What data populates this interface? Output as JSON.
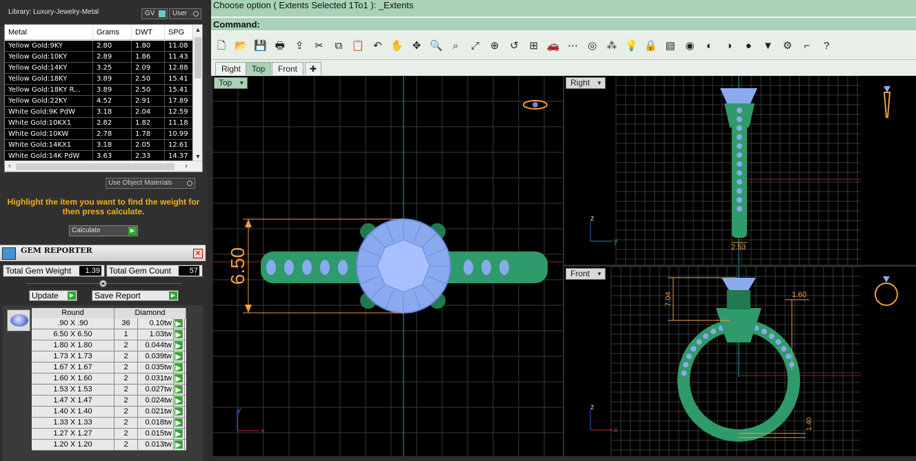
{
  "library": {
    "title": "Library: Luxury-Jewelry-Metal",
    "gv_label": "GV",
    "user_label": "User"
  },
  "metal_table": {
    "headers": [
      "Metal",
      "Grams",
      "DWT",
      "SPG"
    ],
    "rows": [
      [
        "Yellow Gold:9KY",
        "2.80",
        "1.80",
        "11.08"
      ],
      [
        "Yellow Gold:10KY",
        "2.89",
        "1.86",
        "11.43"
      ],
      [
        "Yellow Gold:14KY",
        "3.25",
        "2.09",
        "12.88"
      ],
      [
        "Yellow Gold:18KY",
        "3.89",
        "2.50",
        "15.41"
      ],
      [
        "Yellow Gold:18KY R...",
        "3.89",
        "2.50",
        "15.41"
      ],
      [
        "Yellow Gold:22KY",
        "4.52",
        "2.91",
        "17.89"
      ],
      [
        "White Gold:9K PdW",
        "3.18",
        "2.04",
        "12.59"
      ],
      [
        "White Gold:10KX1",
        "2.82",
        "1.82",
        "11.18"
      ],
      [
        "White Gold:10KW",
        "2.78",
        "1.78",
        "10.99"
      ],
      [
        "White Gold:14KX1",
        "3.18",
        "2.05",
        "12.61"
      ],
      [
        "White Gold:14K PdW",
        "3.63",
        "2.33",
        "14.37"
      ]
    ]
  },
  "use_object_materials": "Use Object Materials",
  "highlight_text": "Highlight the item you want to find the weight for then press calculate.",
  "calculate_label": "Calculate",
  "gem_reporter": {
    "title": "GEM REPORTER",
    "total_weight_label": "Total Gem Weight",
    "total_weight_value": "1.39",
    "total_count_label": "Total Gem Count",
    "total_count_value": "57",
    "update_label": "Update",
    "save_label": "Save Report",
    "headers": [
      "Round",
      "Diamond"
    ],
    "rows": [
      [
        ".90 X .90",
        "36",
        "0.10tw"
      ],
      [
        "6.50 X 6.50",
        "1",
        "1.03tw"
      ],
      [
        "1.80 X 1.80",
        "2",
        "0.044tw"
      ],
      [
        "1.73 X 1.73",
        "2",
        "0.039tw"
      ],
      [
        "1.67 X 1.67",
        "2",
        "0.035tw"
      ],
      [
        "1.60 X 1.60",
        "2",
        "0.031tw"
      ],
      [
        "1.53 X 1.53",
        "2",
        "0.027tw"
      ],
      [
        "1.47 X 1.47",
        "2",
        "0.024tw"
      ],
      [
        "1.40 X 1.40",
        "2",
        "0.021tw"
      ],
      [
        "1.33 X 1.33",
        "2",
        "0.018tw"
      ],
      [
        "1.27 X 1.27",
        "2",
        "0.015tw"
      ],
      [
        "1.20 X 1.20",
        "2",
        "0.013tw"
      ]
    ]
  },
  "command": {
    "history": "Choose option ( Extents  Selected  1To1 ): _Extents",
    "label": "Command:"
  },
  "toolbar_icons": [
    "new-file-icon",
    "open-folder-icon",
    "save-icon",
    "print-icon",
    "import-icon",
    "cut-icon",
    "copy-icon",
    "paste-icon",
    "undo-icon",
    "pan-hand-icon",
    "rotate-view-icon",
    "zoom-icon",
    "zoom-window-icon",
    "zoom-extents-icon",
    "zoom-selected-icon",
    "undo-view-icon",
    "four-viewports-icon",
    "car-icon",
    "snap-icon",
    "circle-icon",
    "points-icon",
    "light-icon",
    "lock-icon",
    "layer-icon",
    "color-wheel-icon",
    "shade-icon",
    "sphere-render-icon",
    "render-icon",
    "spotlight-icon",
    "gear-icon",
    "dimension-icon",
    "help-icon"
  ],
  "viewport_tabs": [
    "Right",
    "Top",
    "Front"
  ],
  "viewports": {
    "top": {
      "label": "Top",
      "dimension": "6.50"
    },
    "right": {
      "label": "Right",
      "dimension": "2.53"
    },
    "front": {
      "label": "Front",
      "dim_height": "7.04",
      "dim_width": "1.60",
      "dim_bottom": "1.40"
    }
  },
  "colors": {
    "metal_green": "#2f9a6a",
    "gem_blue": "#8aaaf0",
    "dim_orange": "#f0a040",
    "highlight_yellow": "#f0b21a",
    "rhino_green": "#a9d2b6"
  }
}
